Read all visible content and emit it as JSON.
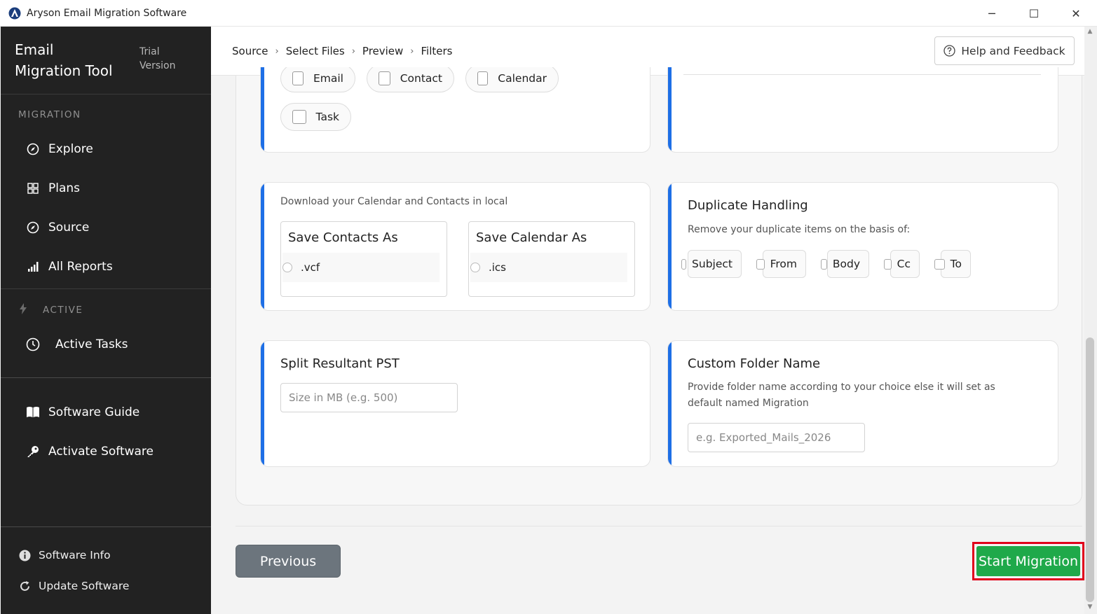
{
  "window": {
    "title": "Aryson Email Migration Software",
    "minimize": "─",
    "maximize": "☐",
    "close": "✕"
  },
  "sidebar": {
    "brand": "Email Migration Tool",
    "trial": "Trial Version",
    "migration_section": "MIGRATION",
    "items": [
      {
        "label": "Explore",
        "icon": "compass-icon"
      },
      {
        "label": "Plans",
        "icon": "grid-icon"
      },
      {
        "label": "Source",
        "icon": "compass-icon"
      },
      {
        "label": "All Reports",
        "icon": "bar-chart-icon"
      }
    ],
    "active_section": "ACTIVE",
    "active_tasks": "Active Tasks",
    "software_guide": "Software Guide",
    "activate_software": "Activate Software",
    "software_info": "Software Info",
    "update_software": "Update Software"
  },
  "header": {
    "breadcrumb": [
      "Source",
      "Select Files",
      "Preview",
      "Filters"
    ],
    "help": "Help and Feedback"
  },
  "item_types": {
    "options": [
      "Email",
      "Contact",
      "Calendar",
      "Task"
    ]
  },
  "download": {
    "subtitle": "Download your Calendar and Contacts in local",
    "contacts_title": "Save Contacts As",
    "contacts_option": ".vcf",
    "calendar_title": "Save Calendar As",
    "calendar_option": ".ics"
  },
  "duplicate": {
    "title": "Duplicate Handling",
    "subtitle": "Remove your duplicate items on the basis of:",
    "options": [
      "Subject",
      "From",
      "Body",
      "Cc",
      "To"
    ]
  },
  "split": {
    "title": "Split Resultant PST",
    "placeholder": "Size in MB (e.g. 500)"
  },
  "custom_folder": {
    "title": "Custom Folder Name",
    "subtitle": "Provide folder name according to your choice else it will set as default named Migration",
    "placeholder": "e.g. Exported_Mails_2026"
  },
  "footer": {
    "previous": "Previous",
    "start": "Start Migration"
  },
  "colors": {
    "sidebar": "#222222",
    "accent": "#1e6fe6",
    "start": "#1fa94a",
    "highlight": "#e0001b",
    "previous": "#6c757d"
  }
}
